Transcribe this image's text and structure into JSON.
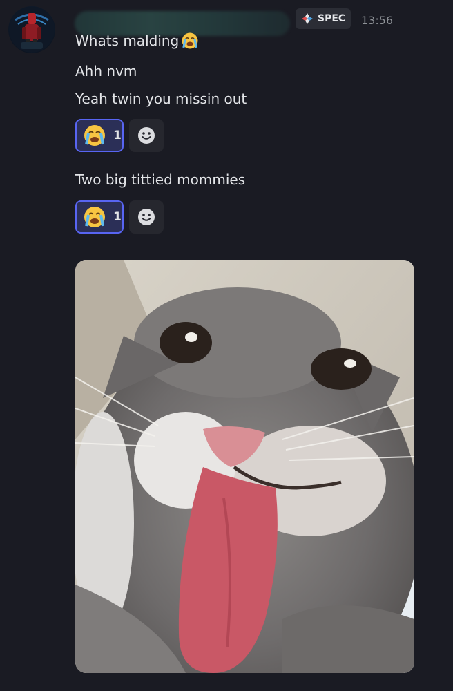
{
  "author": {
    "role_tag": "SPEC",
    "timestamp": "13:56",
    "avatar_icon": "avatar-image"
  },
  "messages": [
    {
      "text": "Whats malding",
      "emoji": "loudly-crying-emoji"
    },
    {
      "text": "Ahh nvm"
    },
    {
      "text": "Yeah twin you missin out"
    },
    {
      "text": "Two big tittied mommies"
    }
  ],
  "reaction_groups": [
    {
      "emoji": "loudly-crying-emoji",
      "count": "1"
    },
    {
      "emoji": "loudly-crying-emoji",
      "count": "1"
    }
  ],
  "attachment": {
    "kind": "image",
    "subject_icon": "cat-sticking-out-tongue-image"
  },
  "colors": {
    "background": "#1a1b23",
    "reaction_active_border": "#5865f2",
    "reaction_active_bg": "#2b2f57",
    "text": "#e3e5e8",
    "timestamp": "#8e9297"
  }
}
